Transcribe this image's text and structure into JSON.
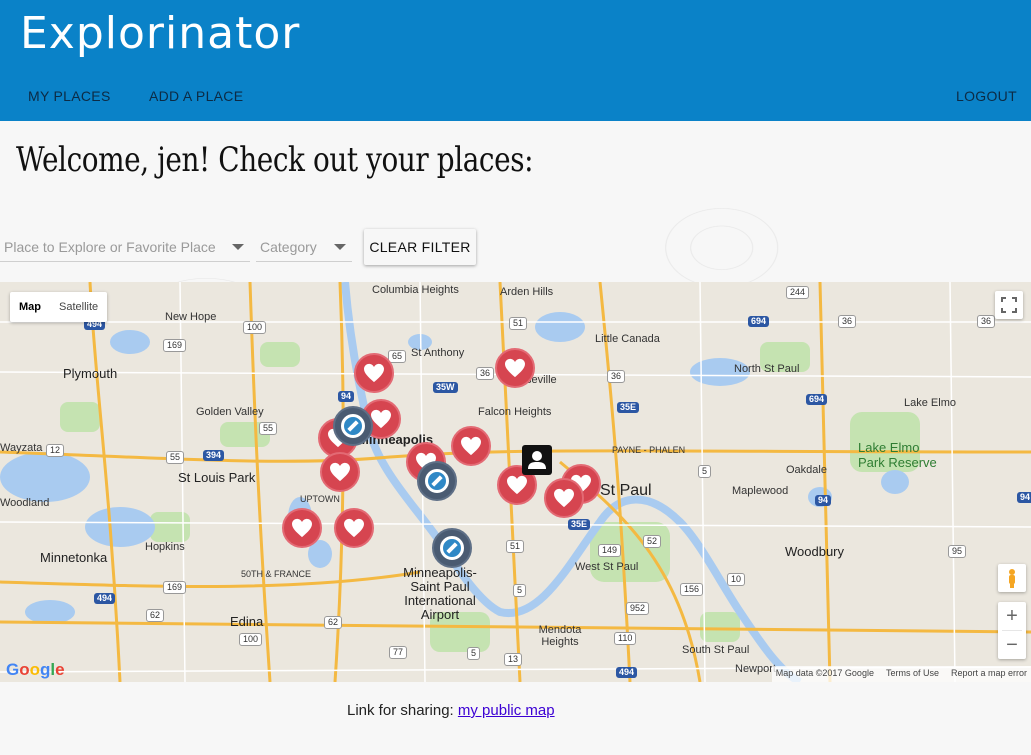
{
  "app": {
    "title": "Explorinator"
  },
  "nav": {
    "my_places": "MY PLACES",
    "add_place": "ADD A PLACE",
    "logout": "LOGOUT"
  },
  "welcome": "Welcome, jen! Check out your places:",
  "filters": {
    "place_type_placeholder": "Place to Explore or Favorite Place",
    "category_placeholder": "Category",
    "clear_label": "CLEAR FILTER"
  },
  "map": {
    "type_map": "Map",
    "type_satellite": "Satellite",
    "attribution": {
      "data": "Map data ©2017 Google",
      "terms": "Terms of Use",
      "report": "Report a map error"
    },
    "logo": "Google",
    "labels": [
      "Columbia Heights",
      "Arden Hills",
      "New Hope",
      "Little Canada",
      "St Anthony",
      "Plymouth",
      "North St Paul",
      "Roseville",
      "Golden Valley",
      "Falcon Heights",
      "Lake Elmo",
      "Wayzata",
      "Minneapolis",
      "Lake Elmo Park Reserve",
      "PAYNE - PHALEN",
      "St Louis Park",
      "Oakdale",
      "UPTOWN",
      "St Paul",
      "Maplewood",
      "Woodland",
      "Minnetonka",
      "Hopkins",
      "Woodbury",
      "50TH & FRANCE",
      "West St Paul",
      "Minneapolis-Saint Paul International Airport",
      "Edina",
      "Mendota Heights",
      "South St Paul",
      "Newport"
    ]
  },
  "share": {
    "prefix": "Link for sharing: ",
    "link": "my public map"
  },
  "colors": {
    "header": "#0a82c8",
    "favorite_pin": "#d64550",
    "explore_pin": "#4a5b72"
  }
}
